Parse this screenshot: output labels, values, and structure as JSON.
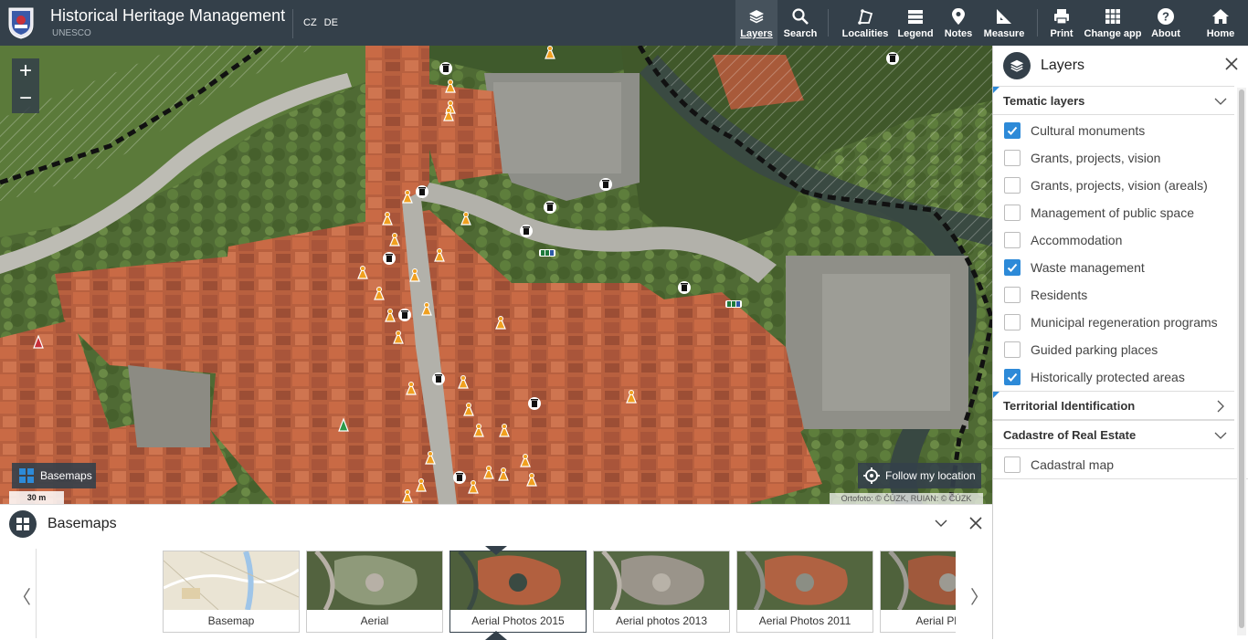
{
  "header": {
    "title": "Historical Heritage Management",
    "subtitle": "UNESCO",
    "languages": [
      "CZ",
      "DE"
    ]
  },
  "toolbar": {
    "layers": "Layers",
    "search": "Search",
    "localities": "Localities",
    "legend": "Legend",
    "notes": "Notes",
    "measure": "Measure",
    "print": "Print",
    "change_app": "Change app",
    "about": "About",
    "home": "Home"
  },
  "map": {
    "zoom_in": "+",
    "zoom_out": "−",
    "basemaps_button": "Basemaps",
    "scale": "30 m",
    "follow_location": "Follow my location",
    "attribution": "Ortofoto: © ČÚZK, RUIAN: © ČÚZK"
  },
  "layers_panel": {
    "title": "Layers",
    "sections": [
      {
        "title": "Tematic layers",
        "expanded": true,
        "items": [
          {
            "label": "Cultural monuments",
            "checked": true
          },
          {
            "label": "Grants, projects, vision",
            "checked": false
          },
          {
            "label": "Grants, projects, vision (areals)",
            "checked": false
          },
          {
            "label": "Management of public space",
            "checked": false
          },
          {
            "label": "Accommodation",
            "checked": false
          },
          {
            "label": "Waste management",
            "checked": true
          },
          {
            "label": "Residents",
            "checked": false
          },
          {
            "label": "Municipal regeneration programs",
            "checked": false
          },
          {
            "label": "Guided parking places",
            "checked": false
          },
          {
            "label": "Historically protected areas",
            "checked": true
          }
        ]
      },
      {
        "title": "Territorial Identification",
        "expanded": false,
        "items": []
      },
      {
        "title": "Cadastre of Real Estate",
        "expanded": true,
        "items": [
          {
            "label": "Cadastral map",
            "checked": false
          }
        ]
      }
    ]
  },
  "basemaps_panel": {
    "title": "Basemaps",
    "prev": "〈",
    "next": "〉",
    "items": [
      {
        "label": "Basemap",
        "selected": false
      },
      {
        "label": "Aerial",
        "selected": false
      },
      {
        "label": "Aerial Photos 2015",
        "selected": true
      },
      {
        "label": "Aerial photos 2013",
        "selected": false
      },
      {
        "label": "Aerial Photos 2011",
        "selected": false
      },
      {
        "label": "Aerial Photos",
        "selected": false
      }
    ]
  },
  "colors": {
    "topbar": "#34404a",
    "accent": "#2d8ad8",
    "monument_marker": "#f0a020",
    "roof": "#b8603f"
  }
}
